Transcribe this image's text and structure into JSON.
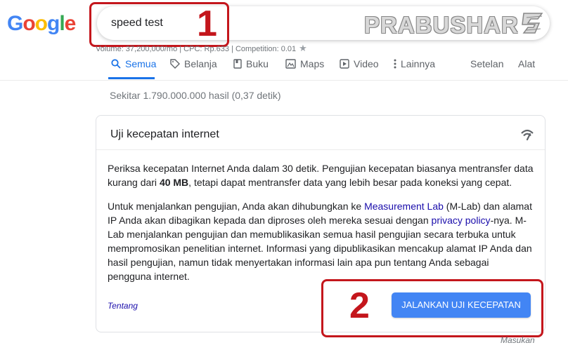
{
  "logo": {
    "letters": [
      "G",
      "o",
      "o",
      "g",
      "l",
      "e"
    ],
    "colors": [
      "#4285f4",
      "#ea4335",
      "#fbbc05",
      "#4285f4",
      "#34a853",
      "#ea4335"
    ]
  },
  "search": {
    "query": "speed test"
  },
  "watermark": {
    "text": "PRABUSHAR"
  },
  "annotations": {
    "step1": "1",
    "step2": "2",
    "color": "#c4161c"
  },
  "keyword_stats": {
    "text": "Volume: 37,200,000/mo | CPC: Rp.633 | Competition: 0.01",
    "star": "★"
  },
  "tabs": {
    "items": [
      {
        "label": "Semua",
        "icon": "search-icon",
        "active": true
      },
      {
        "label": "Belanja",
        "icon": "tag-icon"
      },
      {
        "label": "Buku",
        "icon": "book-icon"
      },
      {
        "label": "Maps",
        "icon": "map-icon"
      },
      {
        "label": "Video",
        "icon": "play-icon"
      },
      {
        "label": "Lainnya",
        "icon": "more-vert-icon"
      }
    ],
    "settings": "Setelan",
    "tools": "Alat"
  },
  "result_stats": "Sekitar 1.790.000.000 hasil (0,37 detik)",
  "card": {
    "title": "Uji kecepatan internet",
    "p1_a": "Periksa kecepatan Internet Anda dalam 30 detik. Pengujian kecepatan biasanya mentransfer data kurang dari ",
    "p1_bold": "40 MB",
    "p1_b": ", tetapi dapat mentransfer data yang lebih besar pada koneksi yang cepat.",
    "p2_a": "Untuk menjalankan pengujian, Anda akan dihubungkan ke ",
    "p2_link1": "Measurement Lab",
    "p2_b": " (M-Lab) dan alamat IP Anda akan dibagikan kepada dan diproses oleh mereka sesuai dengan ",
    "p2_link2": "privacy policy",
    "p2_c": "-nya. M-Lab menjalankan pengujian dan memublikasikan semua hasil pengujian secara terbuka untuk mempromosikan penelitian internet. Informasi yang dipublikasikan mencakup alamat IP Anda dan hasil pengujian, namun tidak menyertakan informasi lain apa pun tentang Anda sebagai pengguna internet.",
    "about": "Tentang",
    "run_button": "JALANKAN UJI KECEPATAN",
    "button_color": "#4285f4"
  },
  "feedback": "Masukan"
}
